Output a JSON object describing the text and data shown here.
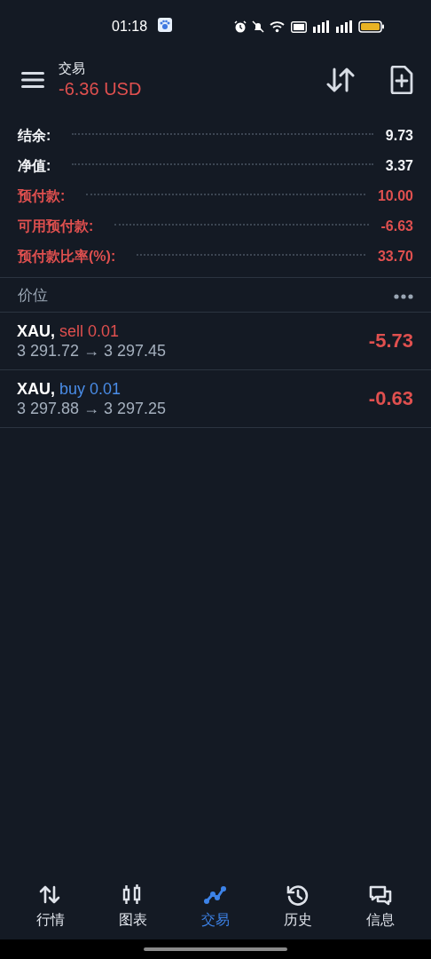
{
  "status_bar": {
    "time": "01:18"
  },
  "header": {
    "title": "交易",
    "balance": "-6.36 USD"
  },
  "summary": [
    {
      "label": "结余:",
      "value": "9.73",
      "alert": false
    },
    {
      "label": "净值:",
      "value": "3.37",
      "alert": false
    },
    {
      "label": "预付款:",
      "value": "10.00",
      "alert": true
    },
    {
      "label": "可用预付款:",
      "value": "-6.63",
      "alert": true
    },
    {
      "label": "预付款比率(%):",
      "value": "33.70",
      "alert": true
    }
  ],
  "positions_header": {
    "title": "价位"
  },
  "positions": [
    {
      "symbol": "XAU,",
      "order": "sell 0.01",
      "kind": "sell",
      "prices": "3 291.72 → 3 297.45",
      "profit": "-5.73"
    },
    {
      "symbol": "XAU,",
      "order": "buy 0.01",
      "kind": "buy",
      "prices": "3 297.88 → 3 297.25",
      "profit": "-0.63"
    }
  ],
  "nav": [
    {
      "label": "行情",
      "selected": false
    },
    {
      "label": "图表",
      "selected": false
    },
    {
      "label": "交易",
      "selected": true
    },
    {
      "label": "历史",
      "selected": false
    },
    {
      "label": "信息",
      "selected": false
    }
  ]
}
